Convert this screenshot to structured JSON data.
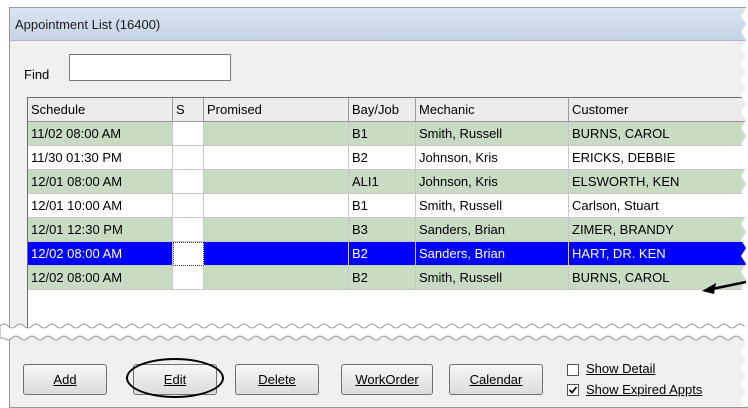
{
  "window": {
    "title": "Appointment List (16400)"
  },
  "find": {
    "label": "Find",
    "value": ""
  },
  "table": {
    "columns": [
      "Schedule",
      "S",
      "Promised",
      "Bay/Job",
      "Mechanic",
      "Customer"
    ],
    "rows": [
      {
        "schedule": "11/02 08:00 AM",
        "s": "",
        "promised": "",
        "bay": "B1",
        "mechanic": "Smith, Russell",
        "customer": "BURNS, CAROL",
        "style": "green"
      },
      {
        "schedule": "11/30 01:30 PM",
        "s": "",
        "promised": "",
        "bay": "B2",
        "mechanic": "Johnson, Kris",
        "customer": "ERICKS, DEBBIE",
        "style": "white"
      },
      {
        "schedule": "12/01 08:00 AM",
        "s": "",
        "promised": "",
        "bay": "ALI1",
        "mechanic": "Johnson, Kris",
        "customer": "ELSWORTH, KEN",
        "style": "green"
      },
      {
        "schedule": "12/01 10:00 AM",
        "s": "",
        "promised": "",
        "bay": "B1",
        "mechanic": "Smith, Russell",
        "customer": "Carlson, Stuart",
        "style": "white"
      },
      {
        "schedule": "12/01 12:30 PM",
        "s": "",
        "promised": "",
        "bay": "B3",
        "mechanic": "Sanders, Brian",
        "customer": "ZIMER, BRANDY",
        "style": "green"
      },
      {
        "schedule": "12/02 08:00 AM",
        "s": "",
        "promised": "",
        "bay": "B2",
        "mechanic": "Sanders, Brian",
        "customer": "HART, DR. KEN",
        "style": "sel"
      },
      {
        "schedule": "12/02 08:00 AM",
        "s": "",
        "promised": "",
        "bay": "B2",
        "mechanic": "Smith, Russell",
        "customer": "BURNS, CAROL",
        "style": "green"
      }
    ]
  },
  "buttons": {
    "add": "Add",
    "edit": "Edit",
    "delete": "Delete",
    "workorder": "WorkOrder",
    "calendar": "Calendar"
  },
  "options": {
    "show_detail": {
      "label": "Show Detail",
      "checked": false
    },
    "show_expired": {
      "label": "Show Expired Appts",
      "checked": true
    }
  },
  "colors": {
    "row_green": "#c8dcc4",
    "row_selected": "#0000ff",
    "titlebar": "#d3dfee"
  },
  "icons": {
    "pointer_arrow": "arrow-left-icon",
    "edit_highlight": "oval-highlight"
  }
}
